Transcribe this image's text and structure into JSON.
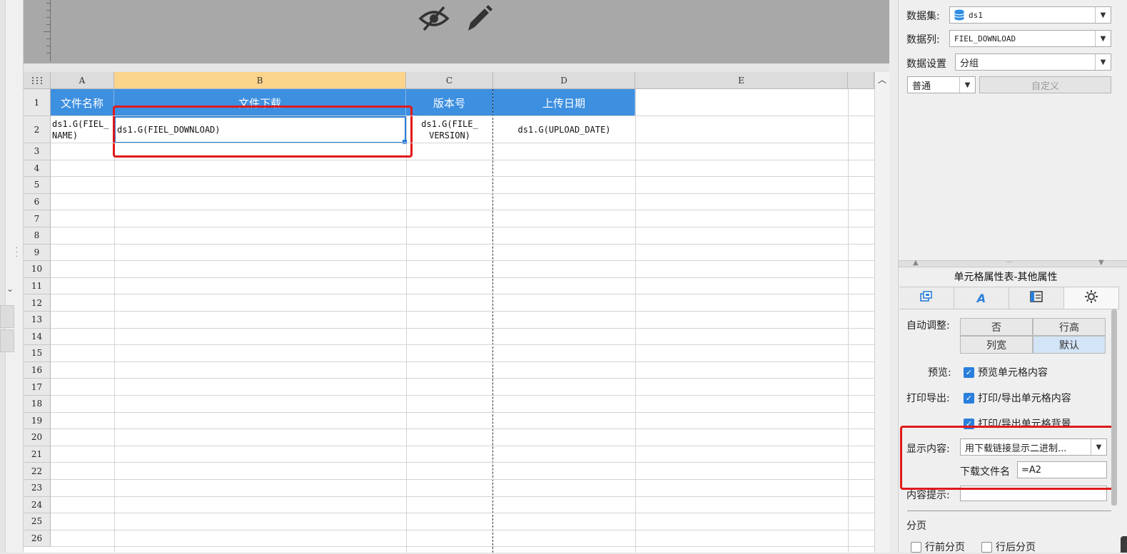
{
  "toolbar": {
    "icons": [
      "eye-slash-icon",
      "pencil-icon"
    ]
  },
  "grid": {
    "corner_icon": "select-all-icon",
    "columns": [
      {
        "label": "A"
      },
      {
        "label": "B"
      },
      {
        "label": "C"
      },
      {
        "label": "D"
      },
      {
        "label": "E"
      }
    ],
    "rows": [
      "1",
      "2",
      "3",
      "4",
      "5",
      "6",
      "7",
      "8",
      "9",
      "10",
      "11",
      "12",
      "13",
      "14",
      "15",
      "16",
      "17",
      "18",
      "19",
      "20",
      "21",
      "22",
      "23",
      "24",
      "25",
      "26"
    ],
    "header_row": [
      "文件名称",
      "文件下载",
      "版本号",
      "上传日期"
    ],
    "data_row": {
      "a": [
        "ds1.G(FIEL_",
        "NAME)"
      ],
      "b": "ds1.G(FIEL_DOWNLOAD)",
      "c": [
        "ds1.G(FILE_",
        "VERSION)"
      ],
      "d": "ds1.G(UPLOAD_DATE)"
    },
    "selected_cell": "B2",
    "accent_header": "#3d8fe0",
    "selected_column_header": "#fbd48b"
  },
  "panel": {
    "dataset_label": "数据集:",
    "dataset_value": "ds1",
    "dataset_icon": "database-icon",
    "column_label": "数据列:",
    "column_value": "FIEL_DOWNLOAD",
    "setting_label": "数据设置",
    "setting_value": "分组",
    "mode_value": "普通",
    "custom_button": "自定义",
    "prop_title": "单元格属性表-其他属性",
    "tabs": [
      "cell-style-icon",
      "font-style-icon",
      "sidebar-layout-icon",
      "gear-icon"
    ],
    "auto_adjust_label": "自动调整:",
    "auto_adjust_options": [
      "否",
      "行高",
      "列宽",
      "默认"
    ],
    "auto_adjust_selected": "默认",
    "preview_label": "预览:",
    "preview_check": "预览单元格内容",
    "print_label": "打印导出:",
    "print_check1": "打印/导出单元格内容",
    "print_check2": "打印/导出单元格背景",
    "display_label": "显示内容:",
    "display_value": "用下载链接显示二进制...",
    "download_name_label": "下载文件名",
    "download_name_value": "=A2",
    "tooltip_label": "内容提示:",
    "tooltip_value": "",
    "paging_label": "分页",
    "page_before": "行前分页",
    "page_after": "行后分页",
    "highlight_color": "#e11919"
  }
}
